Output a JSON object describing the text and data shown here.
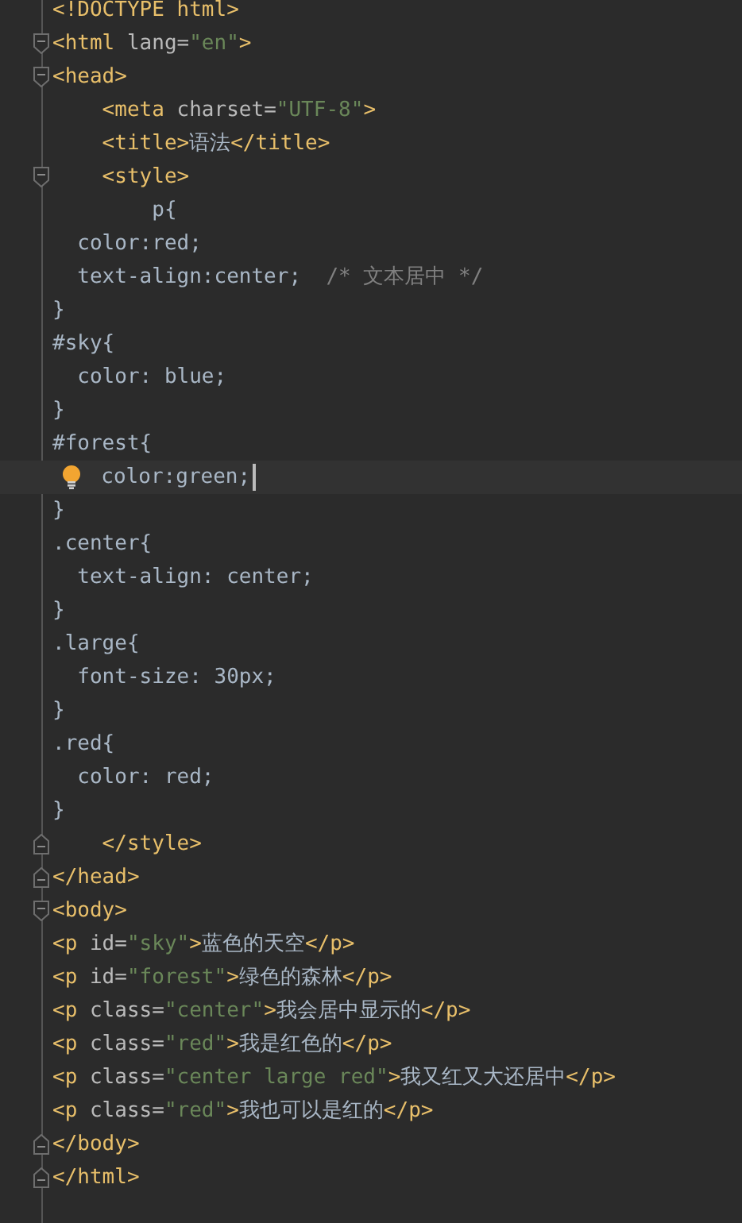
{
  "editor": {
    "lines": [
      {
        "kind": "plain",
        "current": false,
        "tokens": [
          {
            "kind": "tag",
            "text": "<!DOCTYPE html>"
          }
        ]
      },
      {
        "kind": "start",
        "current": false,
        "tokens": [
          {
            "kind": "tag",
            "text": "<html "
          },
          {
            "kind": "attr",
            "text": "lang="
          },
          {
            "kind": "string",
            "text": "\"en\""
          },
          {
            "kind": "tag",
            "text": ">"
          }
        ]
      },
      {
        "kind": "start",
        "current": false,
        "tokens": [
          {
            "kind": "tag",
            "text": "<head>"
          }
        ]
      },
      {
        "kind": "plain",
        "current": false,
        "tokens": [
          {
            "kind": "tag",
            "text": "    <meta "
          },
          {
            "kind": "attr",
            "text": "charset="
          },
          {
            "kind": "string",
            "text": "\"UTF-8\""
          },
          {
            "kind": "tag",
            "text": ">"
          }
        ]
      },
      {
        "kind": "plain",
        "current": false,
        "tokens": [
          {
            "kind": "tag",
            "text": "    <title>"
          },
          {
            "kind": "text",
            "text": "语法"
          },
          {
            "kind": "tag",
            "text": "</title>"
          }
        ]
      },
      {
        "kind": "start",
        "current": false,
        "tokens": [
          {
            "kind": "tag",
            "text": "    <style>"
          }
        ]
      },
      {
        "kind": "plain",
        "current": false,
        "tokens": [
          {
            "kind": "css",
            "text": "        p{"
          }
        ]
      },
      {
        "kind": "plain",
        "current": false,
        "tokens": [
          {
            "kind": "css",
            "text": "  color:red;"
          }
        ]
      },
      {
        "kind": "plain",
        "current": false,
        "tokens": [
          {
            "kind": "css",
            "text": "  text-align:center;  "
          },
          {
            "kind": "comment",
            "text": "/* 文本居中 */"
          }
        ]
      },
      {
        "kind": "plain",
        "current": false,
        "tokens": [
          {
            "kind": "css",
            "text": "}"
          }
        ]
      },
      {
        "kind": "plain",
        "current": false,
        "tokens": [
          {
            "kind": "css",
            "text": "#sky{"
          }
        ]
      },
      {
        "kind": "plain",
        "current": false,
        "tokens": [
          {
            "kind": "css",
            "text": "  color: blue;"
          }
        ]
      },
      {
        "kind": "plain",
        "current": false,
        "tokens": [
          {
            "kind": "css",
            "text": "}"
          }
        ]
      },
      {
        "kind": "plain",
        "current": false,
        "tokens": [
          {
            "kind": "css",
            "text": "#forest{"
          }
        ]
      },
      {
        "kind": "plain",
        "current": true,
        "tokens": [
          {
            "kind": "css",
            "text": "  color:green;"
          }
        ]
      },
      {
        "kind": "plain",
        "current": false,
        "tokens": [
          {
            "kind": "css",
            "text": "}"
          }
        ]
      },
      {
        "kind": "plain",
        "current": false,
        "tokens": [
          {
            "kind": "css",
            "text": ".center{"
          }
        ]
      },
      {
        "kind": "plain",
        "current": false,
        "tokens": [
          {
            "kind": "css",
            "text": "  text-align: center;"
          }
        ]
      },
      {
        "kind": "plain",
        "current": false,
        "tokens": [
          {
            "kind": "css",
            "text": "}"
          }
        ]
      },
      {
        "kind": "plain",
        "current": false,
        "tokens": [
          {
            "kind": "css",
            "text": ".large{"
          }
        ]
      },
      {
        "kind": "plain",
        "current": false,
        "tokens": [
          {
            "kind": "css",
            "text": "  font-size: 30px;"
          }
        ]
      },
      {
        "kind": "plain",
        "current": false,
        "tokens": [
          {
            "kind": "css",
            "text": "}"
          }
        ]
      },
      {
        "kind": "plain",
        "current": false,
        "tokens": [
          {
            "kind": "css",
            "text": ".red{"
          }
        ]
      },
      {
        "kind": "plain",
        "current": false,
        "tokens": [
          {
            "kind": "css",
            "text": "  color: red;"
          }
        ]
      },
      {
        "kind": "plain",
        "current": false,
        "tokens": [
          {
            "kind": "css",
            "text": "}"
          }
        ]
      },
      {
        "kind": "end",
        "current": false,
        "tokens": [
          {
            "kind": "tag",
            "text": "    </style>"
          }
        ]
      },
      {
        "kind": "end",
        "current": false,
        "tokens": [
          {
            "kind": "tag",
            "text": "</head>"
          }
        ]
      },
      {
        "kind": "start",
        "current": false,
        "tokens": [
          {
            "kind": "tag",
            "text": "<body>"
          }
        ]
      },
      {
        "kind": "plain",
        "current": false,
        "tokens": [
          {
            "kind": "tag",
            "text": "<p "
          },
          {
            "kind": "attr",
            "text": "id="
          },
          {
            "kind": "string",
            "text": "\"sky\""
          },
          {
            "kind": "tag",
            "text": ">"
          },
          {
            "kind": "text",
            "text": "蓝色的天空"
          },
          {
            "kind": "tag",
            "text": "</p>"
          }
        ]
      },
      {
        "kind": "plain",
        "current": false,
        "tokens": [
          {
            "kind": "tag",
            "text": "<p "
          },
          {
            "kind": "attr",
            "text": "id="
          },
          {
            "kind": "string",
            "text": "\"forest\""
          },
          {
            "kind": "tag",
            "text": ">"
          },
          {
            "kind": "text",
            "text": "绿色的森林"
          },
          {
            "kind": "tag",
            "text": "</p>"
          }
        ]
      },
      {
        "kind": "plain",
        "current": false,
        "tokens": [
          {
            "kind": "tag",
            "text": "<p "
          },
          {
            "kind": "attr",
            "text": "class="
          },
          {
            "kind": "string",
            "text": "\"center\""
          },
          {
            "kind": "tag",
            "text": ">"
          },
          {
            "kind": "text",
            "text": "我会居中显示的"
          },
          {
            "kind": "tag",
            "text": "</p>"
          }
        ]
      },
      {
        "kind": "plain",
        "current": false,
        "tokens": [
          {
            "kind": "tag",
            "text": "<p "
          },
          {
            "kind": "attr",
            "text": "class="
          },
          {
            "kind": "string",
            "text": "\"red\""
          },
          {
            "kind": "tag",
            "text": ">"
          },
          {
            "kind": "text",
            "text": "我是红色的"
          },
          {
            "kind": "tag",
            "text": "</p>"
          }
        ]
      },
      {
        "kind": "plain",
        "current": false,
        "tokens": [
          {
            "kind": "tag",
            "text": "<p "
          },
          {
            "kind": "attr",
            "text": "class="
          },
          {
            "kind": "string",
            "text": "\"center large red\""
          },
          {
            "kind": "tag",
            "text": ">"
          },
          {
            "kind": "text",
            "text": "我又红又大还居中"
          },
          {
            "kind": "tag",
            "text": "</p>"
          }
        ]
      },
      {
        "kind": "plain",
        "current": false,
        "tokens": [
          {
            "kind": "tag",
            "text": "<p "
          },
          {
            "kind": "attr",
            "text": "class="
          },
          {
            "kind": "string",
            "text": "\"red\""
          },
          {
            "kind": "tag",
            "text": ">"
          },
          {
            "kind": "text",
            "text": "我也可以是红的"
          },
          {
            "kind": "tag",
            "text": "</p>"
          }
        ]
      },
      {
        "kind": "end",
        "current": false,
        "tokens": [
          {
            "kind": "tag",
            "text": "</body>"
          }
        ]
      },
      {
        "kind": "end",
        "current": false,
        "tokens": [
          {
            "kind": "tag",
            "text": "</html>"
          }
        ]
      }
    ]
  }
}
